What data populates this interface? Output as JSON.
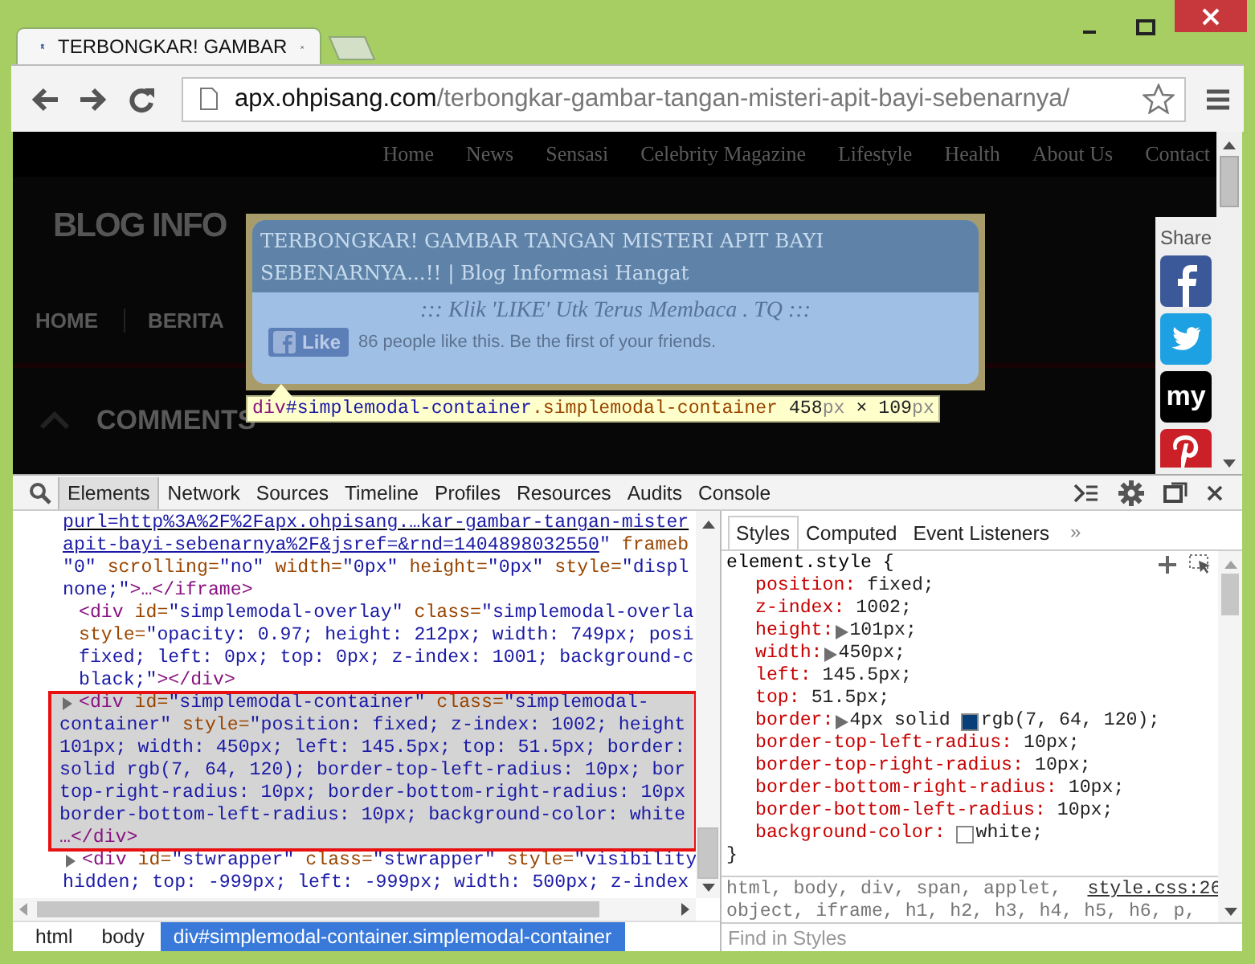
{
  "window": {
    "tab_title": "TERBONGKAR! GAMBAR",
    "url_host": "apx.ohpisang.com",
    "url_path": "/terbongkar-gambar-tangan-misteri-apit-bayi-sebenarnya/"
  },
  "page": {
    "nav": [
      "Home",
      "News",
      "Sensasi",
      "Celebrity Magazine",
      "Lifestyle",
      "Health",
      "About Us",
      "Contact"
    ],
    "blog_title": "BLOG INFO",
    "menu": [
      "HOME",
      "BERITA"
    ],
    "comments_heading": "COMMENTS"
  },
  "modal": {
    "title": "TERBONGKAR! GAMBAR TANGAN MISTERI APIT BAYI SEBENARNYA...!! | Blog Informasi Hangat",
    "subtitle": "::: Klik 'LIKE' Utk Terus Membaca . TQ :::",
    "like_label": "Like",
    "like_text": "86 people like this. Be the first of your friends."
  },
  "highlight_tooltip": [
    {
      "kind": "tag",
      "text": "div"
    },
    {
      "kind": "id",
      "text": "#simplemodal-container"
    },
    {
      "kind": "class",
      "text": ".simplemodal-container"
    },
    {
      "kind": "size",
      "text": " 458"
    },
    {
      "kind": "unit",
      "text": "px"
    },
    {
      "kind": "size",
      "text": " × 109"
    },
    {
      "kind": "unit",
      "text": "px"
    }
  ],
  "share": {
    "label": "Share",
    "buttons": [
      {
        "kind": "facebook"
      },
      {
        "kind": "twitter"
      },
      {
        "kind": "myspace",
        "text": "my"
      },
      {
        "kind": "pinterest"
      }
    ]
  },
  "devtools": {
    "tabs": [
      {
        "label": "Elements",
        "selected": true
      },
      {
        "label": "Network",
        "selected": false
      },
      {
        "label": "Sources",
        "selected": false
      },
      {
        "label": "Timeline",
        "selected": false
      },
      {
        "label": "Profiles",
        "selected": false
      },
      {
        "label": "Resources",
        "selected": false
      },
      {
        "label": "Audits",
        "selected": false
      },
      {
        "label": "Console",
        "selected": false
      }
    ],
    "dom": [
      {
        "kind": "fragment",
        "selected": false,
        "lines": [
          [
            {
              "kind": "link",
              "text": "purl=http%3A%2F%2Fapx.ohpisang.…kar-gambar-tangan-mister"
            }
          ],
          [
            {
              "kind": "link",
              "text": "apit-bayi-sebenarnya%2F&jsref=&rnd=1404898032550"
            },
            {
              "kind": "value",
              "text": "\""
            },
            {
              "kind": "attr",
              "text": " frameb"
            }
          ],
          [
            {
              "kind": "value",
              "text": "\"0\""
            },
            {
              "kind": "attr",
              "text": " scrolling="
            },
            {
              "kind": "value",
              "text": "\"no\""
            },
            {
              "kind": "attr",
              "text": " width="
            },
            {
              "kind": "value",
              "text": "\"0px\""
            },
            {
              "kind": "attr",
              "text": " height="
            },
            {
              "kind": "value",
              "text": "\"0px\""
            },
            {
              "kind": "attr",
              "text": " style="
            },
            {
              "kind": "value",
              "text": "\"displ"
            }
          ],
          [
            {
              "kind": "value",
              "text": "none;\""
            },
            {
              "kind": "tag",
              "text": ">…</iframe>"
            }
          ]
        ]
      },
      {
        "kind": "leaf",
        "selected": false,
        "lines": [
          [
            {
              "kind": "tag",
              "text": "<div"
            },
            {
              "kind": "attr",
              "text": " id="
            },
            {
              "kind": "value",
              "text": "\"simplemodal-overlay\""
            },
            {
              "kind": "attr",
              "text": " class="
            },
            {
              "kind": "value",
              "text": "\"simplemodal-overla"
            }
          ],
          [
            {
              "kind": "attr",
              "text": "style="
            },
            {
              "kind": "value",
              "text": "\"opacity: 0.97; height: 212px; width: 749px; posi"
            }
          ],
          [
            {
              "kind": "value",
              "text": "fixed; left: 0px; top: 0px; z-index: 1001; background-c"
            }
          ],
          [
            {
              "kind": "value",
              "text": "black;\""
            },
            {
              "kind": "tag",
              "text": "></div>"
            }
          ]
        ]
      },
      {
        "kind": "parent",
        "expanded": false,
        "selected": true,
        "lines": [
          [
            {
              "kind": "tag",
              "text": "<div"
            },
            {
              "kind": "attr",
              "text": " id="
            },
            {
              "kind": "value",
              "text": "\"simplemodal-container\""
            },
            {
              "kind": "attr",
              "text": " class="
            },
            {
              "kind": "value",
              "text": "\"simplemodal-"
            }
          ],
          [
            {
              "kind": "value",
              "text": "container\""
            },
            {
              "kind": "attr",
              "text": " style="
            },
            {
              "kind": "value",
              "text": "\"position: fixed; z-index: 1002; height"
            }
          ],
          [
            {
              "kind": "value",
              "text": "101px; width: 450px; left: 145.5px; top: 51.5px; border:"
            }
          ],
          [
            {
              "kind": "value",
              "text": "solid rgb(7, 64, 120); border-top-left-radius: 10px; bor"
            }
          ],
          [
            {
              "kind": "value",
              "text": "top-right-radius: 10px; border-bottom-right-radius: 10px"
            }
          ],
          [
            {
              "kind": "value",
              "text": "border-bottom-left-radius: 10px; background-color: white"
            }
          ],
          [
            {
              "kind": "tag",
              "text": "…</div>"
            }
          ]
        ]
      },
      {
        "kind": "parent",
        "expanded": false,
        "selected": false,
        "lines": [
          [
            {
              "kind": "tag",
              "text": "<div"
            },
            {
              "kind": "attr",
              "text": " id="
            },
            {
              "kind": "value",
              "text": "\"stwrapper\""
            },
            {
              "kind": "attr",
              "text": " class="
            },
            {
              "kind": "value",
              "text": "\"stwrapper\""
            },
            {
              "kind": "attr",
              "text": " style="
            },
            {
              "kind": "value",
              "text": "\"visibility"
            }
          ],
          [
            {
              "kind": "value",
              "text": "hidden; top: -999px; left: -999px; width: 500px; z-index"
            }
          ]
        ]
      }
    ],
    "breadcrumbs": [
      {
        "label": "html",
        "selected": false
      },
      {
        "label": "body",
        "selected": false
      },
      {
        "label": "div#simplemodal-container.simplemodal-container",
        "selected": true
      }
    ],
    "sidebar_tabs": [
      {
        "label": "Styles",
        "selected": true
      },
      {
        "label": "Computed",
        "selected": false
      },
      {
        "label": "Event Listeners",
        "selected": false
      }
    ],
    "sidebar_more": "»",
    "element_style": {
      "selector": "element.style {",
      "properties": [
        {
          "name": "position:",
          "expandable": false,
          "value": "fixed;"
        },
        {
          "name": "z-index:",
          "expandable": false,
          "value": "1002;"
        },
        {
          "name": "height:",
          "expandable": true,
          "value": "101px;"
        },
        {
          "name": "width:",
          "expandable": true,
          "value": "450px;"
        },
        {
          "name": "left:",
          "expandable": false,
          "value": "145.5px;"
        },
        {
          "name": "top:",
          "expandable": false,
          "value": "51.5px;"
        },
        {
          "name": "border:",
          "expandable": true,
          "value": "4px solid",
          "color": "#074078",
          "color_value": "rgb(7, 64, 120);"
        },
        {
          "name": "border-top-left-radius:",
          "expandable": false,
          "value": "10px;"
        },
        {
          "name": "border-top-right-radius:",
          "expandable": false,
          "value": "10px;"
        },
        {
          "name": "border-bottom-right-radius:",
          "expandable": false,
          "value": "10px;"
        },
        {
          "name": "border-bottom-left-radius:",
          "expandable": false,
          "value": "10px;"
        },
        {
          "name": "background-color:",
          "expandable": false,
          "color": "#ffffff",
          "color_value": "white;"
        }
      ],
      "close": "}"
    },
    "matched_rule": {
      "selector_lines": [
        "html, body, div, span, applet,",
        "object, iframe, h1, h2, h3, h4, h5, h6, p,"
      ],
      "source": "style.css:26"
    },
    "filter": {
      "placeholder": "Find in Styles"
    }
  }
}
